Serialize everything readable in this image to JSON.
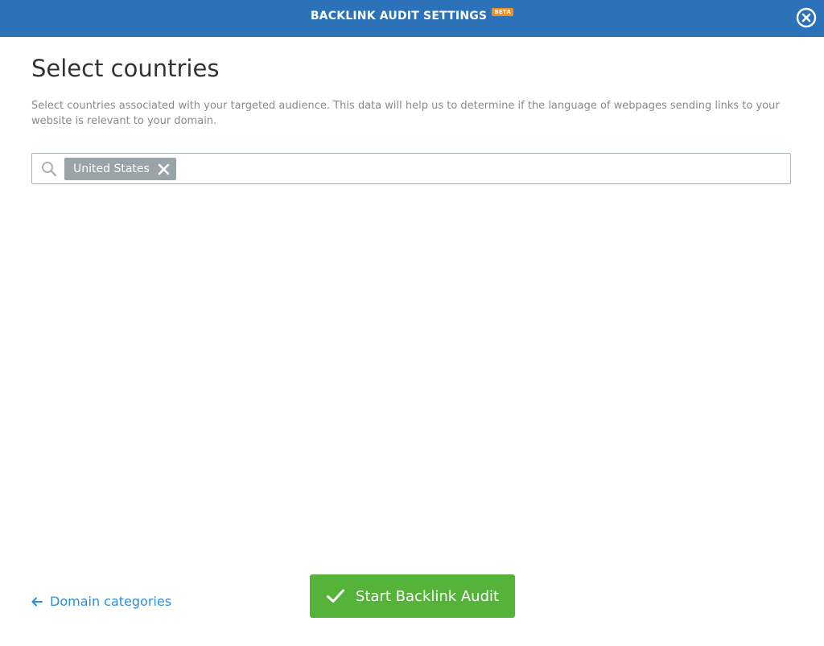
{
  "header": {
    "title": "BACKLINK AUDIT SETTINGS",
    "badge": "BETA",
    "close_icon": "close-circle-icon"
  },
  "page": {
    "title": "Select countries",
    "description": "Select countries associated with your targeted audience. This data will help us to determine if the language of webpages sending links to your website is relevant to your domain."
  },
  "search": {
    "icon": "search-icon",
    "value": "",
    "selected_tags": [
      {
        "label": "United States",
        "remove_icon": "x-icon"
      }
    ]
  },
  "footer": {
    "back_link_label": "Domain categories",
    "back_icon": "arrow-left-icon",
    "start_button_label": "Start Backlink Audit",
    "start_icon": "checkmark-icon"
  },
  "colors": {
    "header_bg": "#2b72b8",
    "beta_badge": "#ff8c1a",
    "tag_bg": "#9aa4a8",
    "link": "#2b8fd8",
    "primary_button": "#55b33a"
  }
}
